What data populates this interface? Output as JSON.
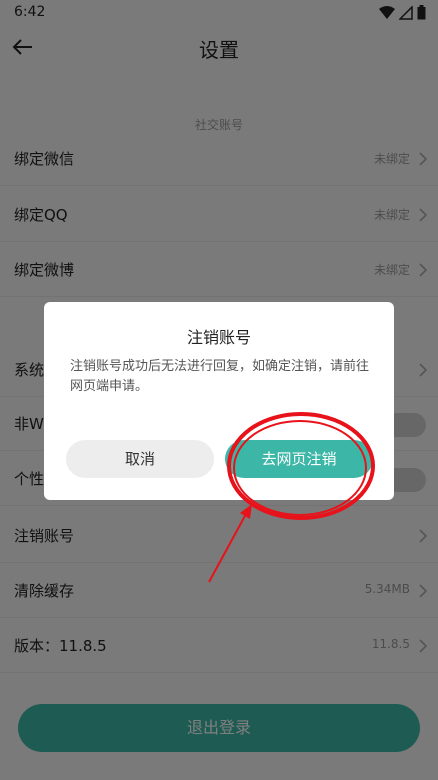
{
  "status_bar": {
    "time": "6:42",
    "icons": [
      "wifi-icon",
      "signal-icon",
      "battery-icon"
    ]
  },
  "header": {
    "title": "设置"
  },
  "section": {
    "social_title": "社交账号"
  },
  "rows": [
    {
      "label": "绑定微信",
      "value": "未绑定"
    },
    {
      "label": "绑定QQ",
      "value": "未绑定"
    },
    {
      "label": "绑定微博",
      "value": "未绑定"
    },
    {
      "label": "系统",
      "value": ""
    },
    {
      "label": "非Wi",
      "value": ""
    },
    {
      "label": "个性",
      "value": ""
    },
    {
      "label": "注销账号",
      "value": ""
    },
    {
      "label": "清除缓存",
      "value": "5.34MB"
    },
    {
      "label": "版本：11.8.5",
      "value": "11.8.5"
    }
  ],
  "logout": {
    "label": "退出登录"
  },
  "dialog": {
    "title": "注销账号",
    "message": "注销账号成功后无法进行回复，如确定注销，请前往网页端申请。",
    "cancel_label": "取消",
    "confirm_label": "去网页注销"
  },
  "colors": {
    "accent": "#3cb6a6",
    "annotation": "#e8121a"
  }
}
